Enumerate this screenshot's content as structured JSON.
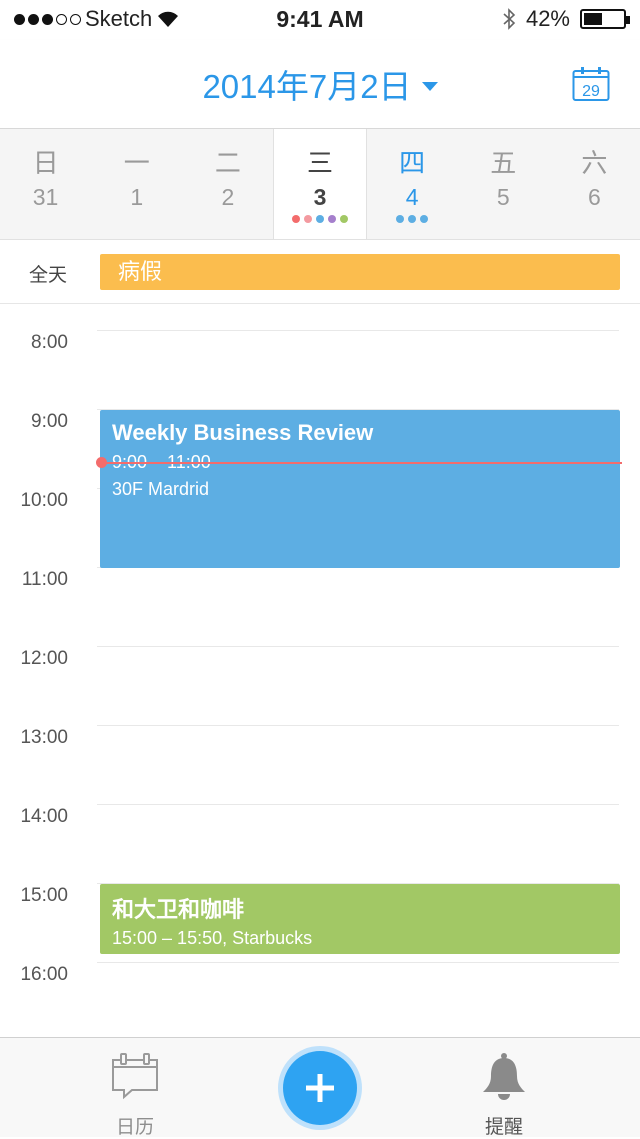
{
  "status_bar": {
    "carrier": "Sketch",
    "time": "9:41 AM",
    "battery_percent": "42%",
    "battery_level": 0.42,
    "signal_bars": 3
  },
  "nav": {
    "title": "2014年7月2日",
    "today_day": "29",
    "accent": "#2b97e8"
  },
  "week": {
    "days": [
      {
        "name": "日",
        "date": "31"
      },
      {
        "name": "一",
        "date": "1"
      },
      {
        "name": "二",
        "date": "2"
      },
      {
        "name": "三",
        "date": "3"
      },
      {
        "name": "四",
        "date": "4"
      },
      {
        "name": "五",
        "date": "5"
      },
      {
        "name": "六",
        "date": "6"
      }
    ],
    "selected_index": 3
  },
  "allday": {
    "label": "全天",
    "event": "病假",
    "color": "#fbbd4e"
  },
  "hours": [
    "8:00",
    "9:00",
    "10:00",
    "11:00",
    "12:00",
    "13:00",
    "14:00",
    "15:00",
    "16:00"
  ],
  "events": {
    "review": {
      "title": "Weekly Business Review",
      "time": "9:00 – 11:00",
      "location": "30F Mardrid",
      "color": "#5daee3"
    },
    "coffee": {
      "title": "和大卫和咖啡",
      "detail": "15:00 – 15:50, Starbucks",
      "color": "#a2c865"
    }
  },
  "now_indicator_color": "#f36c6c",
  "tabbar": {
    "calendar_label": "日历",
    "reminders_label": "提醒"
  }
}
